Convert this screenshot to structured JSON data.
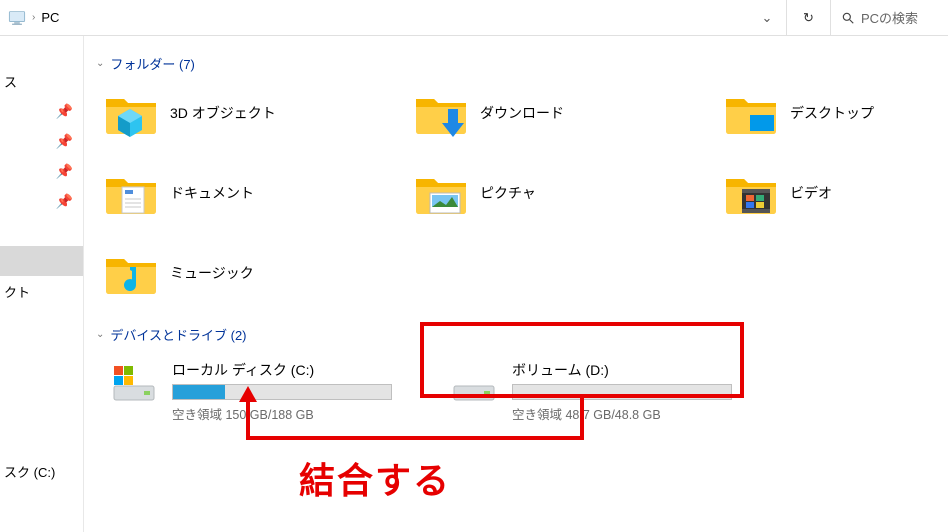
{
  "addressbar": {
    "location": "PC",
    "search_placeholder": "PCの検索"
  },
  "sidebar": {
    "items": [
      {
        "type": "text",
        "label": "ス"
      },
      {
        "type": "pin"
      },
      {
        "type": "pin"
      },
      {
        "type": "pin"
      },
      {
        "type": "pin"
      },
      {
        "type": "spacer"
      },
      {
        "type": "active"
      },
      {
        "type": "text",
        "label": "クト"
      },
      {
        "type": "spacer"
      },
      {
        "type": "spacer"
      },
      {
        "type": "spacer"
      },
      {
        "type": "spacer"
      },
      {
        "type": "spacer"
      },
      {
        "type": "text",
        "label": "スク (C:)"
      }
    ]
  },
  "groups": {
    "folders": {
      "title": "フォルダー (7)"
    },
    "drives": {
      "title": "デバイスとドライブ (2)"
    }
  },
  "folders": [
    {
      "label": "3D オブジェクト"
    },
    {
      "label": "ダウンロード"
    },
    {
      "label": "デスクトップ"
    },
    {
      "label": "ドキュメント"
    },
    {
      "label": "ピクチャ"
    },
    {
      "label": "ビデオ"
    },
    {
      "label": "ミュージック"
    }
  ],
  "drives_list": [
    {
      "name": "ローカル ディスク (C:)",
      "free_text": "空き領域 150 GB/188 GB",
      "fill_pct": 24
    },
    {
      "name": "ボリューム (D:)",
      "free_text": "空き領域 48.7 GB/48.8 GB",
      "fill_pct": 0
    }
  ],
  "annotation": {
    "text": "結合する"
  }
}
